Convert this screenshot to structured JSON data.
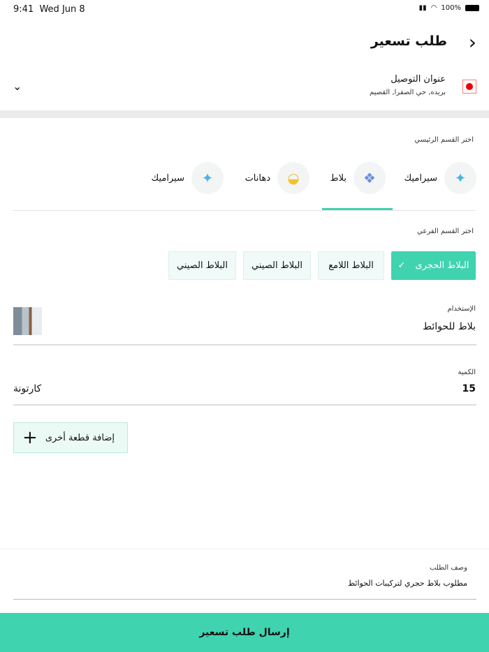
{
  "status": {
    "time": "9:41",
    "date": "Wed Jun 8",
    "battery": "100%"
  },
  "header": {
    "title": "طلب تسعير"
  },
  "address": {
    "title": "عنوان التوصيل",
    "value": "بريده, حي الصفرا, القصيم"
  },
  "main_category": {
    "label": "اختر القسم الرئيسي",
    "items": [
      {
        "label": "سيراميك",
        "icon": "ceramic-tile-icon"
      },
      {
        "label": "بلاط",
        "icon": "tile-icon"
      },
      {
        "label": "دهانات",
        "icon": "paint-bucket-icon"
      },
      {
        "label": "سيراميك",
        "icon": "ceramic-tile-icon"
      }
    ],
    "selected": 1
  },
  "sub_category": {
    "label": "اختر القسم الفرعي",
    "items": [
      "البلاط الحجرى",
      "البلاط اللامع",
      "البلاط الصيني",
      "البلاط الصيني"
    ],
    "selected": 0
  },
  "usage": {
    "label": "الإستخدام",
    "value": "بلاط للحوائط"
  },
  "quantity": {
    "label": "الكمية",
    "value": "15",
    "unit": "كارتونة"
  },
  "add_button": "إضافة قطعة أخرى",
  "description": {
    "label": "وصف الطلب",
    "value": "مطلوب بلاط حجري لتركيبات الحوائط"
  },
  "submit": "إرسال طلب تسعير",
  "colors": {
    "accent": "#3fd3b0"
  }
}
